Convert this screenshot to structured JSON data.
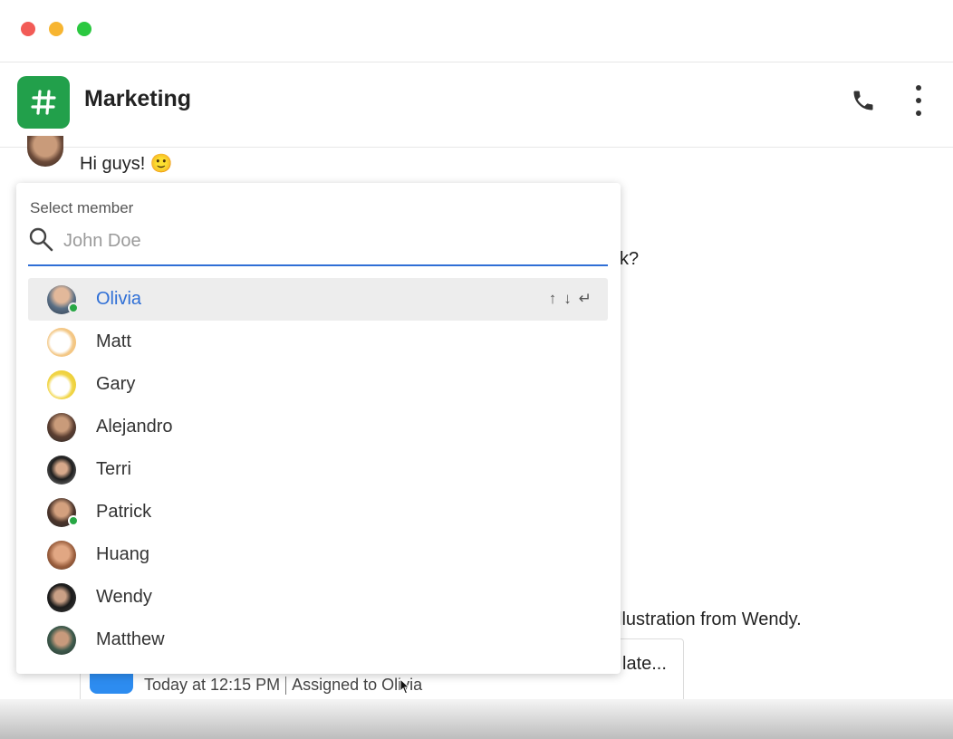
{
  "header": {
    "channel_title": "Marketing",
    "channel_icon": "hash-icon",
    "accent_color": "#22a04b"
  },
  "chat": {
    "greeting": "Hi guys! 🙂",
    "fragment_question": "k?",
    "fragment_illustration": "llustration from Wendy.",
    "task_title_fragment": "late...",
    "task_time": "Today at 12:15 PM",
    "task_assigned": "Assigned to Olivia"
  },
  "popup": {
    "label": "Select member",
    "search_placeholder": "John Doe",
    "key_hints": [
      "↑",
      "↓",
      "↵"
    ],
    "underline_color": "#2f6fd6",
    "members": [
      {
        "name": "Olivia",
        "online": true,
        "selected": true
      },
      {
        "name": "Matt",
        "online": false
      },
      {
        "name": "Gary",
        "online": false
      },
      {
        "name": "Alejandro",
        "online": false
      },
      {
        "name": "Terri",
        "online": false
      },
      {
        "name": "Patrick",
        "online": true
      },
      {
        "name": "Huang",
        "online": false
      },
      {
        "name": "Wendy",
        "online": false
      },
      {
        "name": "Matthew",
        "online": false
      }
    ]
  }
}
